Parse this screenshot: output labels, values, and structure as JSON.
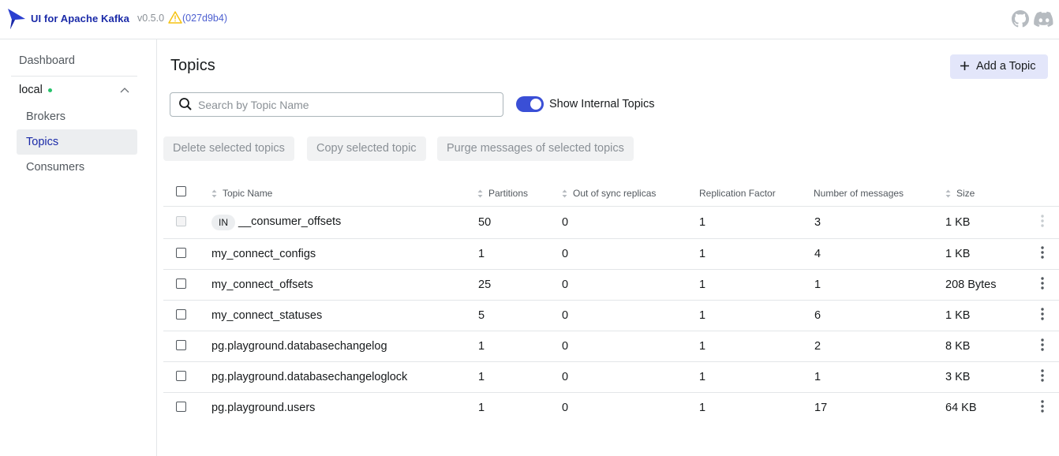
{
  "navbar": {
    "app_title": "UI for Apache Kafka",
    "version": "v0.5.0",
    "commit": "(027d9b4)",
    "icons": [
      "logo-icon",
      "warning-icon",
      "github-icon",
      "discord-icon"
    ]
  },
  "sidebar": {
    "dashboard": "Dashboard",
    "cluster": {
      "name": "local",
      "status_color": "#27c26b"
    },
    "items": [
      {
        "label": "Brokers",
        "active": false
      },
      {
        "label": "Topics",
        "active": true
      },
      {
        "label": "Consumers",
        "active": false
      }
    ]
  },
  "main": {
    "title": "Topics",
    "add_button": "Add a Topic",
    "search_placeholder": "Search by Topic Name",
    "search_value": "",
    "toggle": {
      "label": "Show Internal Topics",
      "on": true
    },
    "actions": [
      "Delete selected topics",
      "Copy selected topic",
      "Purge messages of selected topics"
    ]
  },
  "table": {
    "columns": [
      "Topic Name",
      "Partitions",
      "Out of sync replicas",
      "Replication Factor",
      "Number of messages",
      "Size"
    ],
    "internal_badge": "IN",
    "rows": [
      {
        "name": "__consumer_offsets",
        "internal": true,
        "partitions": "50",
        "out_of_sync": "0",
        "replication": "1",
        "messages": "3",
        "size": "1 KB"
      },
      {
        "name": "my_connect_configs",
        "internal": false,
        "partitions": "1",
        "out_of_sync": "0",
        "replication": "1",
        "messages": "4",
        "size": "1 KB"
      },
      {
        "name": "my_connect_offsets",
        "internal": false,
        "partitions": "25",
        "out_of_sync": "0",
        "replication": "1",
        "messages": "1",
        "size": "208 Bytes"
      },
      {
        "name": "my_connect_statuses",
        "internal": false,
        "partitions": "5",
        "out_of_sync": "0",
        "replication": "1",
        "messages": "6",
        "size": "1 KB"
      },
      {
        "name": "pg.playground.databasechangelog",
        "internal": false,
        "partitions": "1",
        "out_of_sync": "0",
        "replication": "1",
        "messages": "2",
        "size": "8 KB"
      },
      {
        "name": "pg.playground.databasechangeloglock",
        "internal": false,
        "partitions": "1",
        "out_of_sync": "0",
        "replication": "1",
        "messages": "1",
        "size": "3 KB"
      },
      {
        "name": "pg.playground.users",
        "internal": false,
        "partitions": "1",
        "out_of_sync": "0",
        "replication": "1",
        "messages": "17",
        "size": "64 KB"
      }
    ]
  },
  "colors": {
    "accent": "#3a4fd6",
    "brand": "#1a2aa8",
    "status_online": "#27c26b",
    "warning": "#f5c211"
  }
}
